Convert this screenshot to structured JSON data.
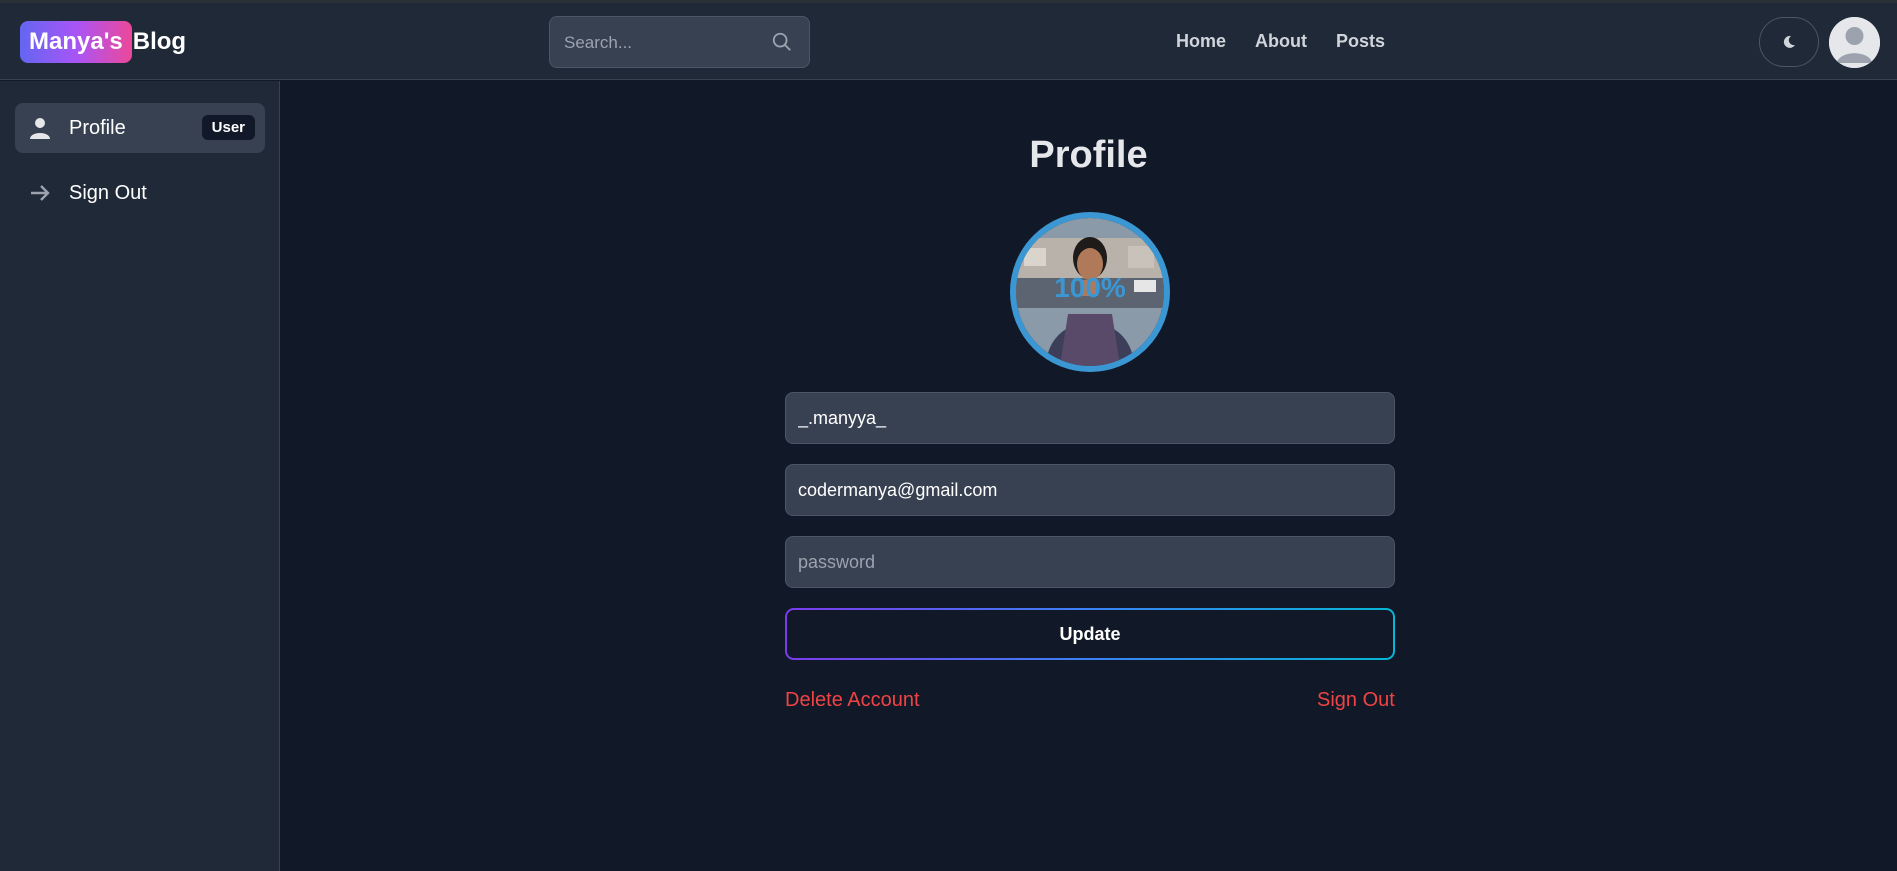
{
  "brand": {
    "badge": "Manya's",
    "text": "Blog"
  },
  "search": {
    "placeholder": "Search..."
  },
  "nav": {
    "links": [
      "Home",
      "About",
      "Posts"
    ]
  },
  "sidebar": {
    "items": [
      {
        "label": "Profile",
        "badge": "User",
        "icon": "user-icon"
      },
      {
        "label": "Sign Out",
        "icon": "arrow-right-icon"
      }
    ]
  },
  "main": {
    "title": "Profile",
    "upload_progress": "100%",
    "username": "_.manyya_",
    "email": "codermanya@gmail.com",
    "password_placeholder": "password",
    "update_label": "Update",
    "delete_label": "Delete Account",
    "signout_label": "Sign Out"
  },
  "colors": {
    "background": "#111827",
    "panel": "#1f2937",
    "accent_red": "#ef4444",
    "progress_blue": "#3b97d3"
  }
}
